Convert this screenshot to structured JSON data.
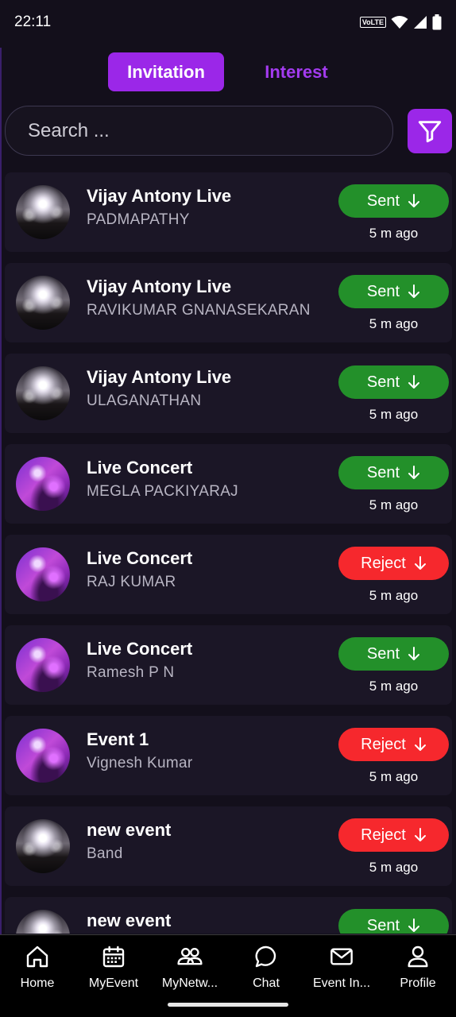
{
  "status_bar": {
    "time": "22:11",
    "volte": "VoLTE"
  },
  "tabs": {
    "active": "Invitation",
    "inactive": "Interest"
  },
  "search": {
    "placeholder": "Search ..."
  },
  "colors": {
    "accent": "#9b27e8",
    "sent": "#23902a",
    "reject": "#f6282d",
    "background": "#130f1b",
    "card": "#1b1626"
  },
  "items": [
    {
      "title": "Vijay Antony Live",
      "subtitle": "PADMAPATHY",
      "status": "Sent",
      "time": "5 m ago",
      "avatar": "crowd"
    },
    {
      "title": "Vijay Antony Live",
      "subtitle": "RAVIKUMAR GNANASEKARAN",
      "status": "Sent",
      "time": "5 m ago",
      "avatar": "crowd"
    },
    {
      "title": "Vijay Antony Live",
      "subtitle": "ULAGANATHAN",
      "status": "Sent",
      "time": "5 m ago",
      "avatar": "crowd"
    },
    {
      "title": "Live Concert",
      "subtitle": "MEGLA PACKIYARAJ",
      "status": "Sent",
      "time": "5 m ago",
      "avatar": "concert"
    },
    {
      "title": "Live Concert",
      "subtitle": "RAJ KUMAR",
      "status": "Reject",
      "time": "5 m ago",
      "avatar": "concert"
    },
    {
      "title": "Live Concert",
      "subtitle": "Ramesh P N",
      "status": "Sent",
      "time": "5 m ago",
      "avatar": "concert"
    },
    {
      "title": "Event 1",
      "subtitle": "Vignesh Kumar",
      "status": "Reject",
      "time": "5 m ago",
      "avatar": "concert"
    },
    {
      "title": "new event",
      "subtitle": "Band",
      "status": "Reject",
      "time": "5 m ago",
      "avatar": "crowd"
    },
    {
      "title": "new event",
      "subtitle": "",
      "status": "Sent",
      "time": "",
      "avatar": "crowd"
    }
  ],
  "nav": [
    {
      "label": "Home",
      "icon": "home-icon"
    },
    {
      "label": "MyEvent",
      "icon": "calendar-icon"
    },
    {
      "label": "MyNetw...",
      "icon": "people-icon"
    },
    {
      "label": "Chat",
      "icon": "chat-icon"
    },
    {
      "label": "Event In...",
      "icon": "mail-icon"
    },
    {
      "label": "Profile",
      "icon": "user-icon"
    }
  ]
}
